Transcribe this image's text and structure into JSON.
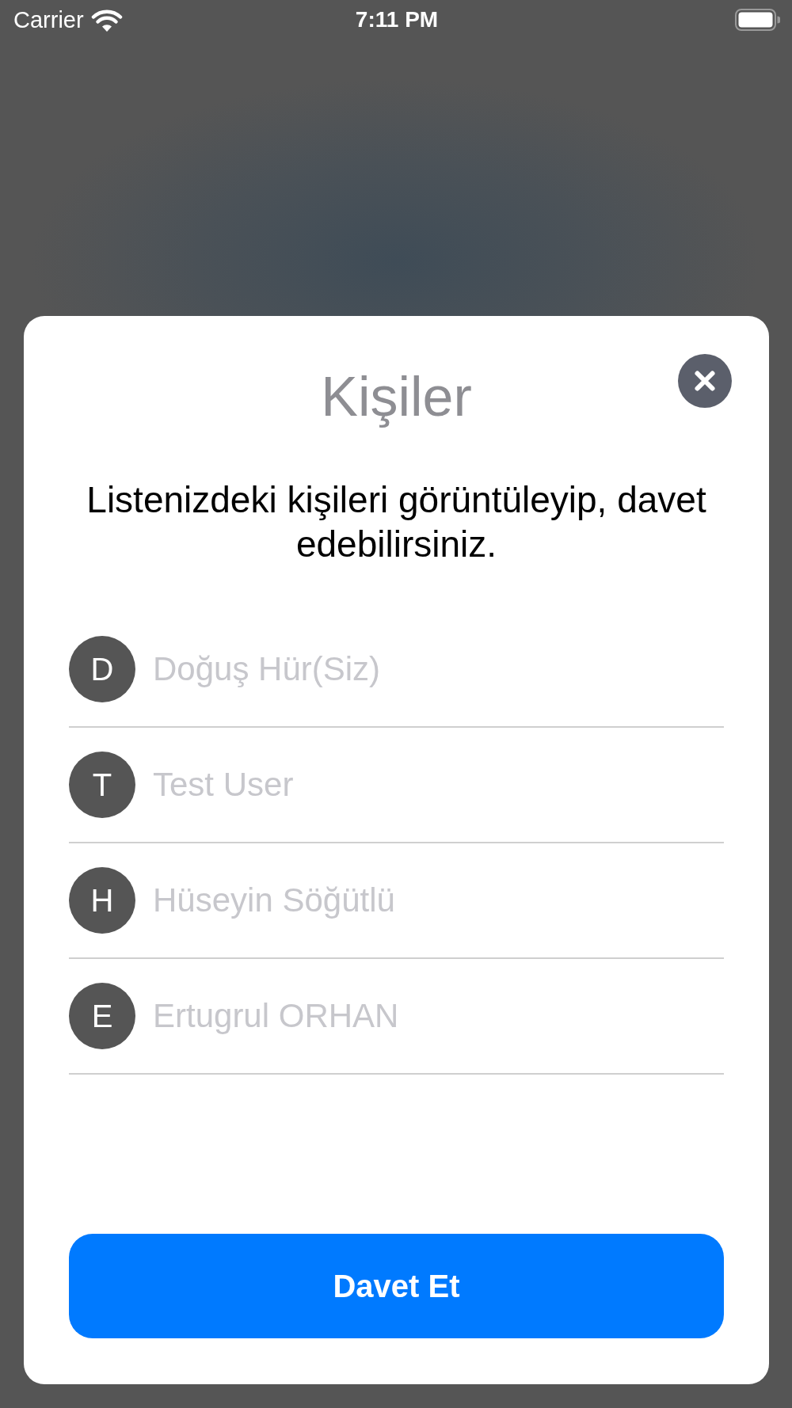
{
  "status_bar": {
    "carrier": "Carrier",
    "time": "7:11 PM"
  },
  "dialog": {
    "title": "Kişiler",
    "description": "Listenizdeki kişileri görüntüleyip, davet edebilirsiniz.",
    "contacts": [
      {
        "initial": "D",
        "name": "Doğuş Hür(Siz)"
      },
      {
        "initial": "T",
        "name": "Test User"
      },
      {
        "initial": "H",
        "name": "Hüseyin Söğütlü"
      },
      {
        "initial": "E",
        "name": "Ertugrul ORHAN"
      }
    ],
    "invite_button": "Davet Et"
  }
}
